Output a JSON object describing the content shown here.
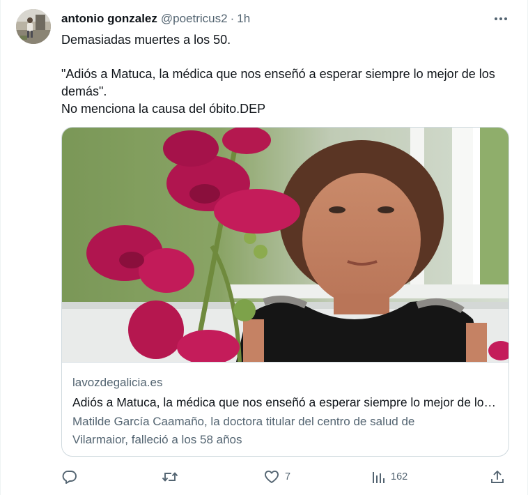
{
  "tweet": {
    "display_name": "antonio gonzalez",
    "handle": "@poetricus2",
    "separator": "·",
    "time": "1h",
    "text_line_1": "Demasiadas muertes a los 50.",
    "text_line_2": "\"Adiós a Matuca, la médica que nos enseñó a esperar siempre lo mejor de los demás\".",
    "text_line_3": "No menciona la causa del óbito.DEP"
  },
  "card": {
    "domain": "lavozdegalicia.es",
    "title": "Adiós a Matuca, la médica que nos enseñó a esperar siempre lo mejor de los demás",
    "description": "Matilde García Caamaño, la doctora titular del centro de salud de Vilarmaior, falleció a los 58 años"
  },
  "actions": {
    "reply_count": "",
    "retweet_count": "",
    "like_count": "7",
    "views_count": "162"
  },
  "colors": {
    "text_primary": "#0f1419",
    "text_secondary": "#536471",
    "border": "#cfd9de",
    "icon": "#536471"
  },
  "icons": {
    "more": "more-horizontal-icon",
    "reply": "reply-icon",
    "retweet": "retweet-icon",
    "like": "heart-icon",
    "views": "views-chart-icon",
    "share": "share-icon"
  }
}
